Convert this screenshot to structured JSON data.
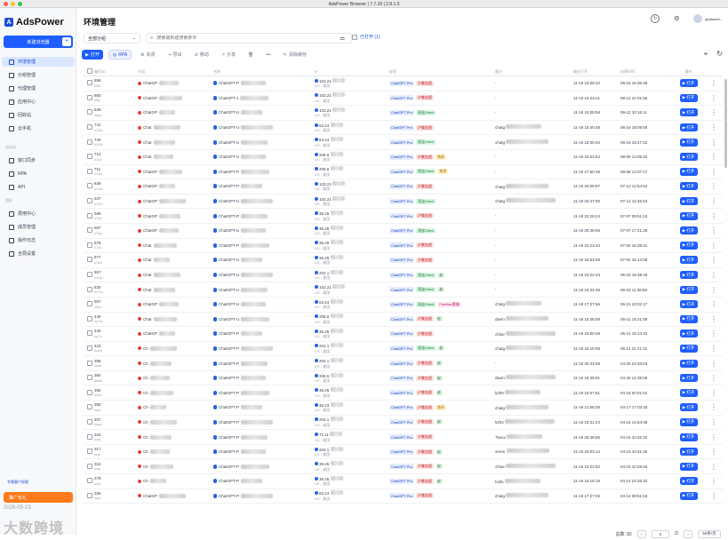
{
  "window": {
    "title": "AdsPower Browser | 7.7.18 | 2.8.1.0"
  },
  "brand": {
    "name": "AdsPower",
    "logo_letter": "A"
  },
  "sidebar": {
    "new_button": "新建浏览器",
    "items": [
      {
        "label": "环境管理",
        "active": true
      },
      {
        "label": "分组管理"
      },
      {
        "label": "代理管理"
      },
      {
        "label": "应用中心"
      },
      {
        "label": "回收站"
      },
      {
        "label": "云手机"
      }
    ],
    "section_auto": "自动化",
    "auto_items": [
      {
        "label": "窗口同步"
      },
      {
        "label": "RPA"
      },
      {
        "label": "API"
      }
    ],
    "section_team": "团队",
    "team_items": [
      {
        "label": "费用中心"
      },
      {
        "label": "成员管理"
      },
      {
        "label": "操作日志"
      },
      {
        "label": "全局设置"
      }
    ],
    "service": "专属客户经理",
    "promo": "推广有礼",
    "date": "2026-05-23",
    "watermark": "大数跨境"
  },
  "header": {
    "title": "环境管理",
    "user": "gbalweizl..."
  },
  "filters": {
    "group": "全部分组",
    "search_placeholder": "搜索或新建搜索条件",
    "opened_label": "已打开 (1)"
  },
  "toolbar": {
    "open": "打开",
    "rpa": "RPA",
    "close": "关闭",
    "export": "导出",
    "move": "移动",
    "share": "分享",
    "delete_icon": "trash-icon",
    "more": "•••",
    "clear_cache": "清除缓存"
  },
  "columns": [
    "编号/ID",
    "分组",
    "名称",
    "IP",
    "标签",
    "备注",
    "最近打开",
    "创建时间",
    "操作"
  ],
  "rows": [
    {
      "id": "856",
      "sid": "k5le",
      "group": "ChatGP",
      "name": "ChatGPT-P",
      "ip": "103.21",
      "loc": "US - 美国",
      "tags": [
        "ChatGPT Pro",
        "沪美加速"
      ],
      "note": "-",
      "last": "11-19 15:39:32",
      "created": "09-16 16:36:38"
    },
    {
      "id": "850",
      "sid": "k5fj",
      "group": "ChatGP",
      "name": "ChatGPT-J",
      "ip": "103.21",
      "loc": "US - 美国",
      "tags": [
        "ChatGPT Pro",
        "沪美加速"
      ],
      "note": "-",
      "last": "11-19 15:23:41",
      "created": "09-12 21:01:56"
    },
    {
      "id": "849",
      "sid": "k5gv",
      "group": "ChatGP",
      "name": "ChatGPT-U",
      "ip": "103.21",
      "loc": "US - 美国",
      "tags": [
        "ChatGPT Pro",
        "直连Direct"
      ],
      "note": "-",
      "last": "11-19 15:05:58",
      "created": "09-12 10:16:11"
    },
    {
      "id": "741",
      "sid": "k1O6",
      "group": "Chat",
      "name": "ChatGPT-U",
      "ip": "63.24",
      "loc": "US - 美国",
      "tags": [
        "ChatGPT Pro",
        "沪美加速"
      ],
      "note": "chatg",
      "last": "11-19 15:40:48",
      "created": "08-19 18:09:59"
    },
    {
      "id": "740",
      "sid": "k1O6",
      "group": "Chat",
      "name": "ChatGPT-U",
      "ip": "63.24",
      "loc": "US - 美国",
      "tags": [
        "ChatGPT Pro",
        "直连Direct"
      ],
      "note": "chatg",
      "last": "11-19 15:00:40",
      "created": "08-19 18:47:42"
    },
    {
      "id": "712",
      "sid": "k1oe",
      "group": "Chat",
      "name": "ChatGPT-U",
      "ip": "208.6",
      "loc": "US - 美国",
      "tags": [
        "ChatGPT Pro",
        "沪美加速",
        "独享"
      ],
      "note": "-",
      "last": "11-19 15:52:54",
      "created": "08-08 14:05:40"
    },
    {
      "id": "711",
      "sid": "k1od",
      "group": "ChatGP",
      "name": "ChatGPT-P",
      "ip": "208.6",
      "loc": "US - 美国",
      "tags": [
        "ChatGPT Pro",
        "直连Direct",
        "独享"
      ],
      "note": "-",
      "last": "11-19 17:50:48",
      "created": "08-08 14:07:17"
    },
    {
      "id": "638",
      "sid": "k1Gb",
      "group": "ChatGP",
      "name": "ChatGPT-P",
      "ip": "103.21",
      "loc": "US - 美国",
      "tags": [
        "ChatGPT Pro",
        "沪美加速"
      ],
      "note": "chatg",
      "last": "11-19 20:09:07",
      "created": "07-12 12:54:52"
    },
    {
      "id": "637",
      "sid": "k1Gb",
      "group": "ChatGP",
      "name": "ChatGPT-U",
      "ip": "103.21",
      "loc": "US - 美国",
      "tags": [
        "ChatGPT Pro",
        "直连Direct"
      ],
      "note": "chatg",
      "last": "11-19 20:47:00",
      "created": "07-12 12:46:53"
    },
    {
      "id": "588",
      "sid": "k7bb",
      "group": "ChatGP",
      "name": "ChatGPT-P",
      "ip": "36.26",
      "loc": "US - 美国",
      "tags": [
        "ChatGPT Pro",
        "沪美加速"
      ],
      "note": "-",
      "last": "11-19 23:26:24",
      "created": "07-07 09:51:24"
    },
    {
      "id": "587",
      "sid": "k7ba",
      "group": "ChatGP",
      "name": "ChatGPT-U",
      "ip": "36.25",
      "loc": "US - 美国",
      "tags": [
        "ChatGPT Pro",
        "直连Direct"
      ],
      "note": "-",
      "last": "11-19 20:48:06",
      "created": "07-07 17:21:28"
    },
    {
      "id": "578",
      "sid": "k7a1",
      "group": "Chat",
      "name": "ChatGPT-P",
      "ip": "36.25",
      "loc": "US - 美国",
      "tags": [
        "ChatGPT Pro",
        "沪美加速"
      ],
      "note": "-",
      "last": "11-19 22:23:43",
      "created": "07-02 16:39:31"
    },
    {
      "id": "577",
      "sid": "k7a0",
      "group": "Chat",
      "name": "ChatGPT-U",
      "ip": "36.25",
      "loc": "US - 美国",
      "tags": [
        "ChatGPT Pro",
        "沪美加速"
      ],
      "note": "-",
      "last": "11-19 16:53:08",
      "created": "07-02 16:14:08"
    },
    {
      "id": "557",
      "sid": "k1Gp",
      "group": "Chat",
      "name": "ChatGPT-U",
      "ip": "204.1",
      "loc": "US - 美国",
      "tags": [
        "ChatGPT Pro",
        "直连Direct",
        "赵"
      ],
      "note": "-",
      "last": "11-18 23:22:44",
      "created": "06-23 18:39:19"
    },
    {
      "id": "530",
      "sid": "k1Gq",
      "group": "Chat",
      "name": "ChatGPT-U",
      "ip": "103.21",
      "loc": "US - 美国",
      "tags": [
        "ChatGPT Pro",
        "直连Direct",
        "赵"
      ],
      "note": "-",
      "last": "11-19 16:22:38",
      "created": "06-23 11:39:58"
    },
    {
      "id": "507",
      "sid": "k0bv",
      "group": "ChatGP",
      "name": "ChatGPT-U",
      "ip": "63.24",
      "loc": "US - 美国",
      "tags": [
        "ChatGPT Pro",
        "直连Direct",
        "FireMax套餐"
      ],
      "note": "chatg",
      "last": "11-19 17:27:56",
      "created": "06-21 23:02:17"
    },
    {
      "id": "440",
      "sid": "kp7w",
      "group": "Chat",
      "name": "ChatGPT-U",
      "ip": "208.6",
      "loc": "US - 美国",
      "tags": [
        "ChatGPT Pro",
        "沪美加速",
        "赵"
      ],
      "note": "davin",
      "last": "11-19 15:26:08",
      "created": "05-21 19:21:08"
    },
    {
      "id": "430",
      "sid": "kp7o",
      "group": "ChatGP",
      "name": "ChatGPT-P",
      "ip": "36.25",
      "loc": "US - 美国",
      "tags": [
        "ChatGPT Pro",
        "沪美加速"
      ],
      "note": "chloe",
      "last": "11-19 15:50:49",
      "created": "05-14 15:14:42"
    },
    {
      "id": "423",
      "sid": "kwp4",
      "group": "Ch",
      "name": "ChatGPT-P",
      "ip": "204.1",
      "loc": "US - 美国",
      "tags": [
        "ChatGPT Pro",
        "直连Direct",
        "赵"
      ],
      "note": "chatg",
      "last": "11-19 15:15:08",
      "created": "05-14 21:21:31"
    },
    {
      "id": "396",
      "sid": "kwni",
      "group": "Ch",
      "name": "ChatGPT-P",
      "ip": "204.1",
      "loc": "US - 美国",
      "tags": [
        "ChatGPT Pro",
        "沪美加速",
        "赵"
      ],
      "note": "-",
      "last": "11-19 20:43:08",
      "created": "04-26 22:40:03"
    },
    {
      "id": "384",
      "sid": "kwkk",
      "group": "Ch",
      "name": "ChatGPT-P",
      "ip": "208.6",
      "loc": "US - 美国",
      "tags": [
        "ChatGPT Pro",
        "沪美加速",
        "赵"
      ],
      "note": "davin",
      "last": "11-19 15:36:01",
      "created": "04-26 12:35:06"
    },
    {
      "id": "356",
      "sid": "kwb1",
      "group": "Ch",
      "name": "ChatGPT-P",
      "ip": "36.25",
      "loc": "US - 美国",
      "tags": [
        "ChatGPT Pro",
        "沪美加速",
        "赵"
      ],
      "note": "k2h0",
      "last": "11-19 15:07:51",
      "created": "04-18 00:01:01"
    },
    {
      "id": "350",
      "sid": "kwa",
      "group": "Ch",
      "name": "ChatGPT-P",
      "ip": "46.23",
      "loc": "US - 美国",
      "tags": [
        "ChatGPT Pro",
        "沪美加速",
        "独享"
      ],
      "note": "chatg",
      "last": "11-19 21:58:28",
      "created": "04-17 17:03:45"
    },
    {
      "id": "337",
      "sid": "kwpu",
      "group": "Ch",
      "name": "ChatGPT-P",
      "ip": "204.1",
      "loc": "US - 美国",
      "tags": [
        "ChatGPT Pro",
        "沪美加速",
        "赵"
      ],
      "note": "k2h2",
      "last": "11-19 15:31:24",
      "created": "04-15 14:54:06"
    },
    {
      "id": "318",
      "sid": "kwp",
      "group": "Ch",
      "name": "ChatGPT-P",
      "ip": "72.11",
      "loc": "US - 美国",
      "tags": [
        "ChatGPT Pro",
        "沪美加速"
      ],
      "note": "7kevx",
      "last": "11-19 20:48:56",
      "created": "04-15 10:32:32"
    },
    {
      "id": "317",
      "sid": "kwp",
      "group": "Ch",
      "name": "ChatGPT-P",
      "ip": "204.1",
      "loc": "US - 美国",
      "tags": [
        "ChatGPT Pro",
        "沪美加速",
        "赵"
      ],
      "note": "seren",
      "last": "11-19 22:03:14",
      "created": "04-15 10:31:35"
    },
    {
      "id": "316",
      "sid": "kwp",
      "group": "Ch",
      "name": "ChatGPT-P",
      "ip": "36.25",
      "loc": "US - 美国",
      "tags": [
        "ChatGPT Pro",
        "沪美加速",
        "赵"
      ],
      "note": "chloe",
      "last": "11-19 15:22:52",
      "created": "04-15 10:29:45"
    },
    {
      "id": "276",
      "sid": "kwa",
      "group": "Ch",
      "name": "ChatGPT-P",
      "ip": "36.25",
      "loc": "US - 美国",
      "tags": [
        "ChatGPT Pro",
        "沪美加速",
        "赵"
      ],
      "note": "hollo",
      "last": "11-19 15:15:19",
      "created": "04-14 24:26:32"
    },
    {
      "id": "256",
      "sid": "kwa",
      "group": "ChatGP",
      "name": "ChatGPT-P",
      "ip": "63.24",
      "loc": "US - 美国",
      "tags": [
        "ChatGPT Pro",
        "沪美加速"
      ],
      "note": "chatg",
      "last": "11-19 17:27:26",
      "created": "04-14 08:51:53"
    }
  ],
  "row_action": "打开",
  "footer": {
    "total": "总数: 82",
    "page": "2",
    "pages": "/2",
    "per_page": "50条/页"
  }
}
